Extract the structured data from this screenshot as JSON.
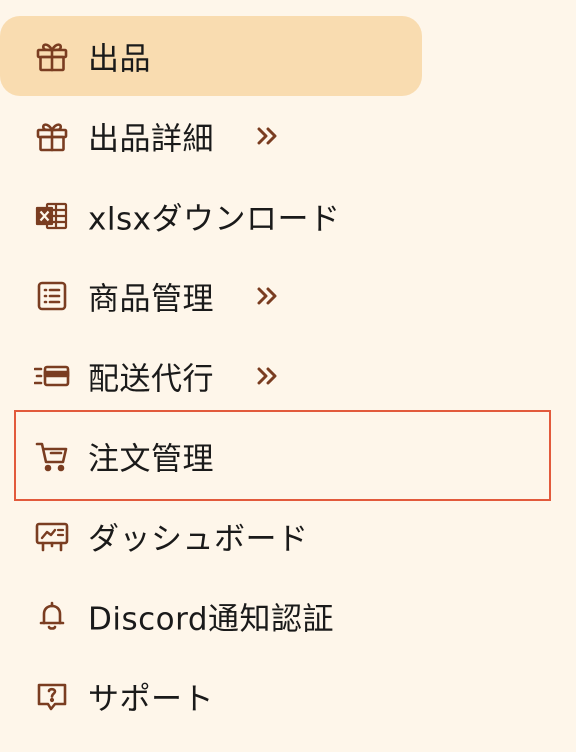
{
  "colors": {
    "background": "#fef6ea",
    "active_background": "#f9dcb0",
    "icon": "#7a3d21",
    "text": "#1a1a1a",
    "highlight_border": "#e25a3c"
  },
  "menu": {
    "items": [
      {
        "label": "出品",
        "icon": "gift-icon",
        "active": true,
        "has_submenu": false
      },
      {
        "label": "出品詳細",
        "icon": "gift-icon",
        "active": false,
        "has_submenu": true
      },
      {
        "label": "xlsxダウンロード",
        "icon": "excel-icon",
        "active": false,
        "has_submenu": false
      },
      {
        "label": "商品管理",
        "icon": "list-icon",
        "active": false,
        "has_submenu": true
      },
      {
        "label": "配送代行",
        "icon": "card-list-icon",
        "active": false,
        "has_submenu": true
      },
      {
        "label": "注文管理",
        "icon": "cart-icon",
        "active": false,
        "has_submenu": false,
        "highlighted": true
      },
      {
        "label": "ダッシュボード",
        "icon": "dashboard-icon",
        "active": false,
        "has_submenu": false
      },
      {
        "label": "Discord通知認証",
        "icon": "bell-icon",
        "active": false,
        "has_submenu": false
      },
      {
        "label": "サポート",
        "icon": "help-message-icon",
        "active": false,
        "has_submenu": false
      }
    ]
  }
}
